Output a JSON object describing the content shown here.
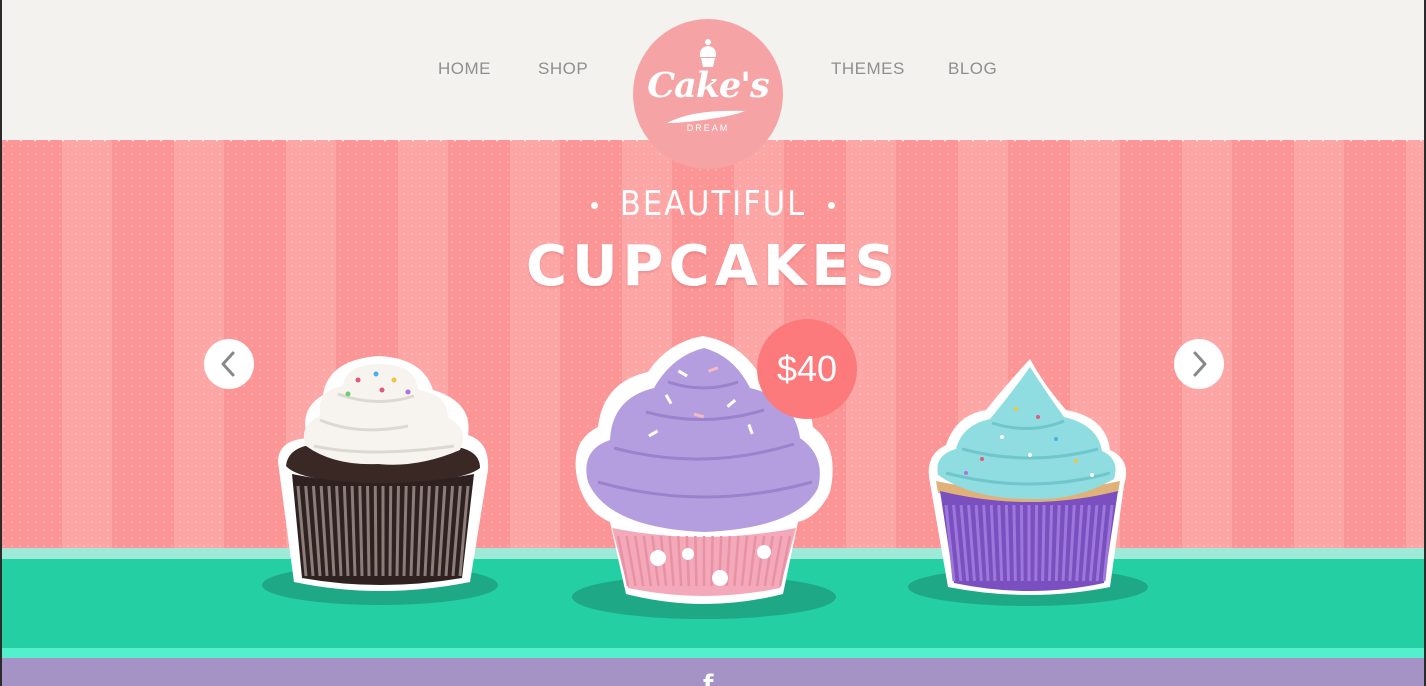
{
  "nav": {
    "items": [
      {
        "label": "HOME"
      },
      {
        "label": "SHOP"
      },
      {
        "label": "THEMES"
      },
      {
        "label": "BLOG"
      }
    ]
  },
  "logo": {
    "title": "Cake's",
    "subtitle": "DREAM"
  },
  "hero": {
    "subtitle": "BEAUTIFUL",
    "title": "CUPCAKES",
    "price": "$40"
  },
  "carousel": {
    "prev_icon": "chevron-left-icon",
    "next_icon": "chevron-right-icon",
    "products": [
      {
        "name": "chocolate-cupcake",
        "frosting": "#f7f4f0",
        "wrapper": "#ffffff",
        "cake": "#3a2825"
      },
      {
        "name": "lavender-cupcake",
        "frosting": "#b59ee0",
        "wrapper": "#f3a9b9",
        "cake": "#f3a9b9"
      },
      {
        "name": "mint-cupcake",
        "frosting": "#8fdde0",
        "wrapper": "#7a4fc0",
        "cake": "#e0b27a"
      }
    ]
  },
  "colors": {
    "hero_pink": "#fc9c9d",
    "table_green": "#24cfa4",
    "footer_purple": "#a593c6",
    "badge_red": "#fd7a7c"
  },
  "footer": {
    "social_icon": "facebook-icon",
    "social_glyph": "f"
  }
}
